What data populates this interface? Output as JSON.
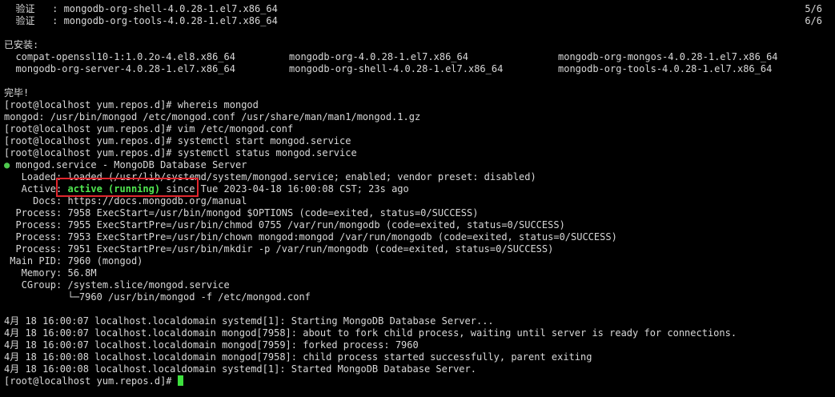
{
  "verify_lines": [
    {
      "label": "  验证   ",
      "package": ": mongodb-org-shell-4.0.28-1.el7.x86_64",
      "progress": "5/6"
    },
    {
      "label": "  验证   ",
      "package": ": mongodb-org-tools-4.0.28-1.el7.x86_64",
      "progress": "6/6"
    }
  ],
  "installed_header": "已安装:",
  "installed_rows": [
    [
      "  compat-openssl10-1:1.0.2o-4.el8.x86_64",
      "mongodb-org-4.0.28-1.el7.x86_64",
      "mongodb-org-mongos-4.0.28-1.el7.x86_64"
    ],
    [
      "  mongodb-org-server-4.0.28-1.el7.x86_64",
      "mongodb-org-shell-4.0.28-1.el7.x86_64",
      "mongodb-org-tools-4.0.28-1.el7.x86_64"
    ]
  ],
  "done": "完毕!",
  "commands": [
    "[root@localhost yum.repos.d]# whereis mongod",
    "mongod: /usr/bin/mongod /etc/mongod.conf /usr/share/man/man1/mongod.1.gz",
    "[root@localhost yum.repos.d]# vim /etc/mongod.conf",
    "[root@localhost yum.repos.d]# systemctl start mongod.service",
    "[root@localhost yum.repos.d]# systemctl status mongod.service"
  ],
  "status": {
    "bullet": "●",
    "unit_line": " mongod.service - MongoDB Database Server",
    "loaded": "   Loaded: loaded (/usr/lib/systemd/system/mongod.service; enabled; vendor preset: disabled)",
    "active_prefix": "   Active: ",
    "active_state": "active (running)",
    "active_suffix": " since Tue 2023-04-18 16:00:08 CST; 23s ago",
    "details": [
      "     Docs: https://docs.mongodb.org/manual",
      "  Process: 7958 ExecStart=/usr/bin/mongod $OPTIONS (code=exited, status=0/SUCCESS)",
      "  Process: 7955 ExecStartPre=/usr/bin/chmod 0755 /var/run/mongodb (code=exited, status=0/SUCCESS)",
      "  Process: 7953 ExecStartPre=/usr/bin/chown mongod:mongod /var/run/mongodb (code=exited, status=0/SUCCESS)",
      "  Process: 7951 ExecStartPre=/usr/bin/mkdir -p /var/run/mongodb (code=exited, status=0/SUCCESS)",
      " Main PID: 7960 (mongod)",
      "   Memory: 56.8M",
      "   CGroup: /system.slice/mongod.service",
      "           └─7960 /usr/bin/mongod -f /etc/mongod.conf"
    ]
  },
  "journal": [
    "4月 18 16:00:07 localhost.localdomain systemd[1]: Starting MongoDB Database Server...",
    "4月 18 16:00:07 localhost.localdomain mongod[7958]: about to fork child process, waiting until server is ready for connections.",
    "4月 18 16:00:07 localhost.localdomain mongod[7959]: forked process: 7960",
    "4月 18 16:00:08 localhost.localdomain mongod[7958]: child process started successfully, parent exiting",
    "4月 18 16:00:08 localhost.localdomain systemd[1]: Started MongoDB Database Server."
  ],
  "prompt": "[root@localhost yum.repos.d]# ",
  "colors": {
    "background": "#000000",
    "text": "#d8d8d8",
    "active": "#50e650",
    "highlight_border": "#e0262d",
    "cursor": "#3ee03e"
  }
}
